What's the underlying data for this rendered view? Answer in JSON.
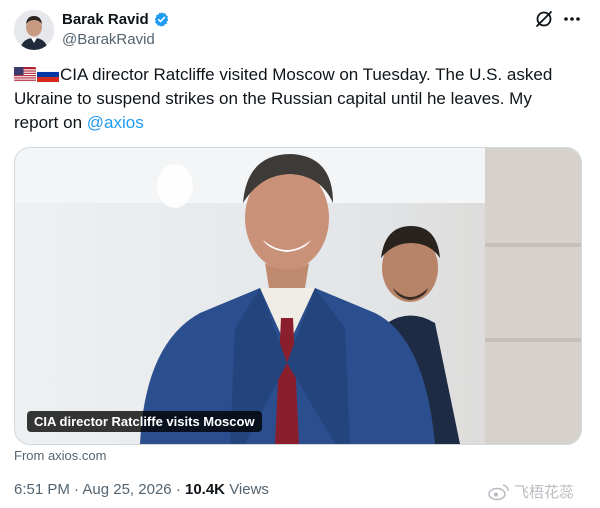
{
  "author": {
    "name": "Barak Ravid",
    "handle": "@BarakRavid",
    "verified": true
  },
  "icons": {
    "grok": "grok-icon",
    "more": "more-icon",
    "verified": "verified-badge-icon"
  },
  "tweet": {
    "flags": [
      "us-flag",
      "russia-flag"
    ],
    "text": "CIA director Ratcliffe visited Moscow on Tuesday. The U.S. asked Ukraine to suspend strikes on the Russian capital until he leaves. My report on ",
    "mention": "@axios"
  },
  "card": {
    "caption": "CIA director Ratcliffe visits Moscow",
    "source": "From axios.com"
  },
  "meta": {
    "time": "6:51 PM",
    "date": "Aug 25, 2026",
    "views_count": "10.4K",
    "views_label": "Views",
    "separator": "·"
  },
  "watermark": {
    "text": "飞梧花蕊"
  },
  "colors": {
    "accent": "#1d9bf0",
    "text": "#0f1419",
    "secondary": "#536471"
  }
}
